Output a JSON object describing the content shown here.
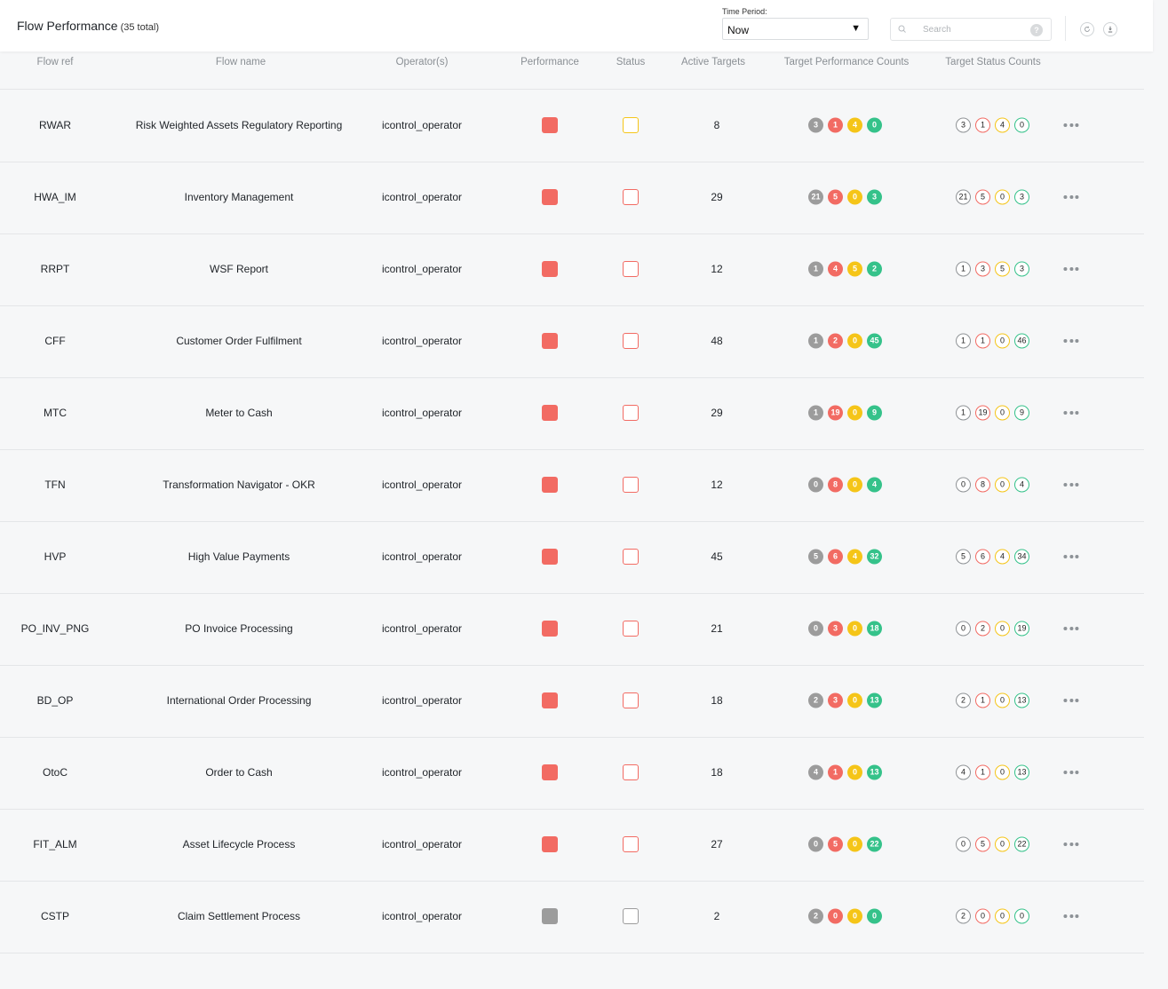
{
  "header": {
    "title": "Flow Performance",
    "total": "(35 total)",
    "time_period_label": "Time Period:",
    "time_period_value": "Now",
    "search_placeholder": "Search",
    "help_label": "?"
  },
  "colors": {
    "red": "#f26b63",
    "grey": "#9c9c9c",
    "yellow": "#f5c518",
    "green": "#35c28a",
    "amber_outline": "#f5c518"
  },
  "columns": [
    "Flow ref",
    "Flow name",
    "Operator(s)",
    "Performance",
    "Status",
    "Active Targets",
    "Target Performance Counts",
    "Target Status Counts"
  ],
  "rows": [
    {
      "ref": "RWAR",
      "name": "Risk Weighted Assets Regulatory Reporting",
      "operator": "icontrol_operator",
      "performance": "red",
      "status": "yellow",
      "active": "8",
      "perf_counts": [
        "3",
        "1",
        "4",
        "0"
      ],
      "status_counts": [
        "3",
        "1",
        "4",
        "0"
      ]
    },
    {
      "ref": "HWA_IM",
      "name": "Inventory Management",
      "operator": "icontrol_operator",
      "performance": "red",
      "status": "red",
      "active": "29",
      "perf_counts": [
        "21",
        "5",
        "0",
        "3"
      ],
      "status_counts": [
        "21",
        "5",
        "0",
        "3"
      ]
    },
    {
      "ref": "RRPT",
      "name": "WSF Report",
      "operator": "icontrol_operator",
      "performance": "red",
      "status": "red",
      "active": "12",
      "perf_counts": [
        "1",
        "4",
        "5",
        "2"
      ],
      "status_counts": [
        "1",
        "3",
        "5",
        "3"
      ]
    },
    {
      "ref": "CFF",
      "name": "Customer Order Fulfilment",
      "operator": "icontrol_operator",
      "performance": "red",
      "status": "red",
      "active": "48",
      "perf_counts": [
        "1",
        "2",
        "0",
        "45"
      ],
      "status_counts": [
        "1",
        "1",
        "0",
        "46"
      ]
    },
    {
      "ref": "MTC",
      "name": "Meter to Cash",
      "operator": "icontrol_operator",
      "performance": "red",
      "status": "red",
      "active": "29",
      "perf_counts": [
        "1",
        "19",
        "0",
        "9"
      ],
      "status_counts": [
        "1",
        "19",
        "0",
        "9"
      ]
    },
    {
      "ref": "TFN",
      "name": "Transformation Navigator - OKR",
      "operator": "icontrol_operator",
      "performance": "red",
      "status": "red",
      "active": "12",
      "perf_counts": [
        "0",
        "8",
        "0",
        "4"
      ],
      "status_counts": [
        "0",
        "8",
        "0",
        "4"
      ]
    },
    {
      "ref": "HVP",
      "name": "High Value Payments",
      "operator": "icontrol_operator",
      "performance": "red",
      "status": "red",
      "active": "45",
      "perf_counts": [
        "5",
        "6",
        "4",
        "32"
      ],
      "status_counts": [
        "5",
        "6",
        "4",
        "34"
      ]
    },
    {
      "ref": "PO_INV_PNG",
      "name": "PO Invoice Processing",
      "operator": "icontrol_operator",
      "performance": "red",
      "status": "red",
      "active": "21",
      "perf_counts": [
        "0",
        "3",
        "0",
        "18"
      ],
      "status_counts": [
        "0",
        "2",
        "0",
        "19"
      ]
    },
    {
      "ref": "BD_OP",
      "name": "International Order Processing",
      "operator": "icontrol_operator",
      "performance": "red",
      "status": "red",
      "active": "18",
      "perf_counts": [
        "2",
        "3",
        "0",
        "13"
      ],
      "status_counts": [
        "2",
        "1",
        "0",
        "13"
      ]
    },
    {
      "ref": "OtoC",
      "name": "Order to Cash",
      "operator": "icontrol_operator",
      "performance": "red",
      "status": "red",
      "active": "18",
      "perf_counts": [
        "4",
        "1",
        "0",
        "13"
      ],
      "status_counts": [
        "4",
        "1",
        "0",
        "13"
      ]
    },
    {
      "ref": "FIT_ALM",
      "name": "Asset Lifecycle Process",
      "operator": "icontrol_operator",
      "performance": "red",
      "status": "red",
      "active": "27",
      "perf_counts": [
        "0",
        "5",
        "0",
        "22"
      ],
      "status_counts": [
        "0",
        "5",
        "0",
        "22"
      ]
    },
    {
      "ref": "CSTP",
      "name": "Claim Settlement Process",
      "operator": "icontrol_operator",
      "performance": "grey",
      "status": "grey",
      "active": "2",
      "perf_counts": [
        "2",
        "0",
        "0",
        "0"
      ],
      "status_counts": [
        "2",
        "0",
        "0",
        "0"
      ]
    }
  ],
  "icons": {
    "dropdown": "caret-down-icon",
    "search": "search-icon",
    "help": "help-icon",
    "refresh": "refresh-icon",
    "download": "download-icon",
    "row_menu": "more-horizontal-icon"
  }
}
